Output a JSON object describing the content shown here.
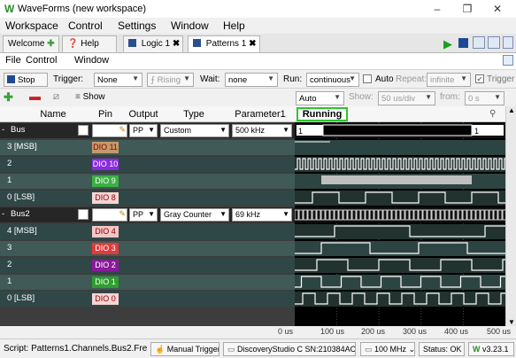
{
  "window": {
    "title": "WaveForms (new workspace)",
    "min": "–",
    "max": "❐",
    "close": "✕"
  },
  "menu": [
    "Workspace",
    "Control",
    "Settings",
    "Window",
    "Help"
  ],
  "tabs": [
    {
      "label": "Welcome",
      "icon": "plus-icon"
    },
    {
      "label": "Help",
      "icon": "help-icon"
    },
    {
      "label": "Logic 1",
      "icon": "logic-icon"
    },
    {
      "label": "Patterns 1",
      "icon": "patterns-icon"
    }
  ],
  "submenu": [
    "File",
    "Control",
    "Window"
  ],
  "toolbar": {
    "stop": "Stop",
    "trigger_label": "Trigger:",
    "trigger_value": "None",
    "rising": "Rising",
    "wait_label": "Wait:",
    "wait_value": "none",
    "run_label": "Run:",
    "run_value": "continuous",
    "auto": "Auto",
    "repeat_label": "Repeat:",
    "repeat_value": "infinite",
    "trigger2": "Trigger"
  },
  "toolbar2": {
    "show": "Show",
    "auto": "Auto",
    "show_label": "Show:",
    "show_value": "50 us/div",
    "from_label": "from:",
    "from_value": "0 s"
  },
  "headers": {
    "name": "Name",
    "pin": "Pin",
    "output": "Output",
    "type": "Type",
    "param": "Parameter1",
    "status": "Running"
  },
  "rows": [
    {
      "name": "Bus",
      "pin": "",
      "output": "PP",
      "type": "Custom",
      "param": "500 kHz",
      "group": true
    },
    {
      "name": "3 [MSB]",
      "pin": "DIO 11",
      "pin_bg": "#c49a6c"
    },
    {
      "name": "2",
      "pin": "DIO 10",
      "pin_bg": "#8a2be2"
    },
    {
      "name": "1",
      "pin": "DIO 9",
      "pin_bg": "#3cb043"
    },
    {
      "name": "0 [LSB]",
      "pin": "DIO 8",
      "pin_bg": "#f7d4d4"
    },
    {
      "name": "Bus2",
      "pin": "",
      "output": "PP",
      "type": "Gray Counter",
      "param": "69 kHz",
      "group": true
    },
    {
      "name": "4 [MSB]",
      "pin": "DIO 4",
      "pin_bg": "#f5c6c6"
    },
    {
      "name": "3",
      "pin": "DIO 3",
      "pin_bg": "#e03c3c"
    },
    {
      "name": "2",
      "pin": "DIO 2",
      "pin_bg": "#8b1a9b"
    },
    {
      "name": "1",
      "pin": "DIO 1",
      "pin_bg": "#2e9e2e"
    },
    {
      "name": "0 [LSB]",
      "pin": "DIO 0",
      "pin_bg": "#f7d4d4"
    }
  ],
  "bus_labels": {
    "first": "1",
    "last": "1"
  },
  "timeline": [
    "0 us",
    "100 us",
    "200 us",
    "300 us",
    "400 us",
    "500 us"
  ],
  "status": {
    "script": "Script: Patterns1.Channels.Bus2.Fre",
    "manual": "Manual Trigger",
    "device": "DiscoveryStudio C SN:210384AC945D",
    "freq": "100 MHz",
    "status": "Status: OK",
    "version": "v3.23.1"
  }
}
